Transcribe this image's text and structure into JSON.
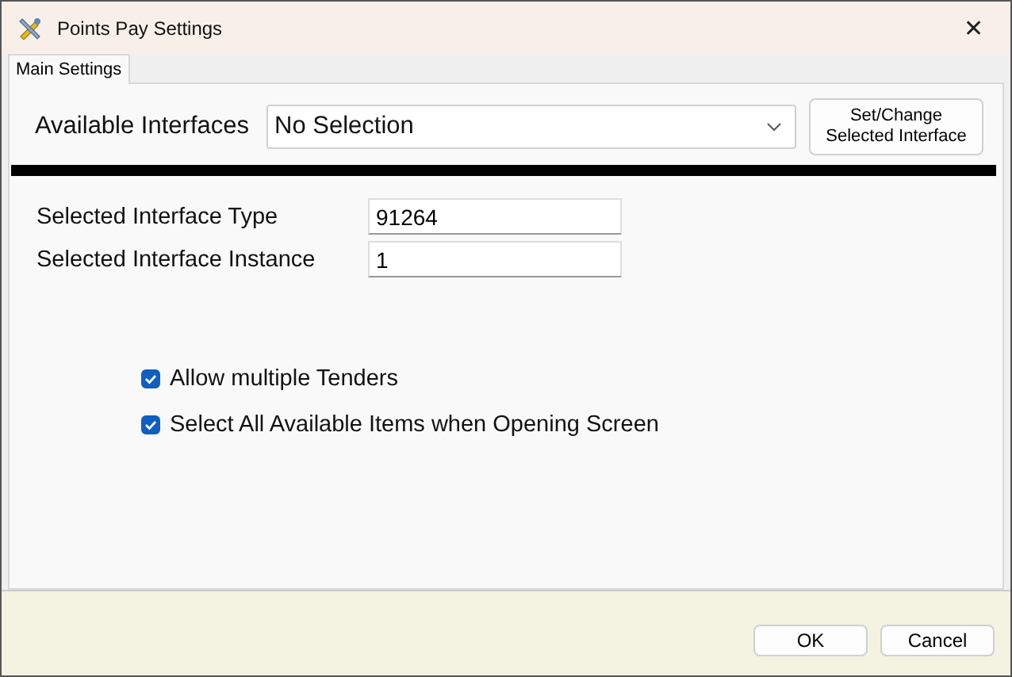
{
  "window": {
    "title": "Points Pay Settings",
    "close": "✕"
  },
  "tabs": [
    {
      "label": "Main Settings",
      "selected": true
    }
  ],
  "interfaces": {
    "label": "Available Interfaces",
    "value": "No Selection",
    "button": "Set/Change\nSelected Interface"
  },
  "fields": [
    {
      "label": "Selected Interface Type",
      "value": "91264"
    },
    {
      "label": "Selected Interface Instance",
      "value": "1"
    }
  ],
  "options": [
    {
      "label": "Allow multiple Tenders",
      "checked": true
    },
    {
      "label": "Select All Available Items when Opening Screen",
      "checked": true
    }
  ],
  "buttons": [
    "OK",
    "Cancel"
  ]
}
